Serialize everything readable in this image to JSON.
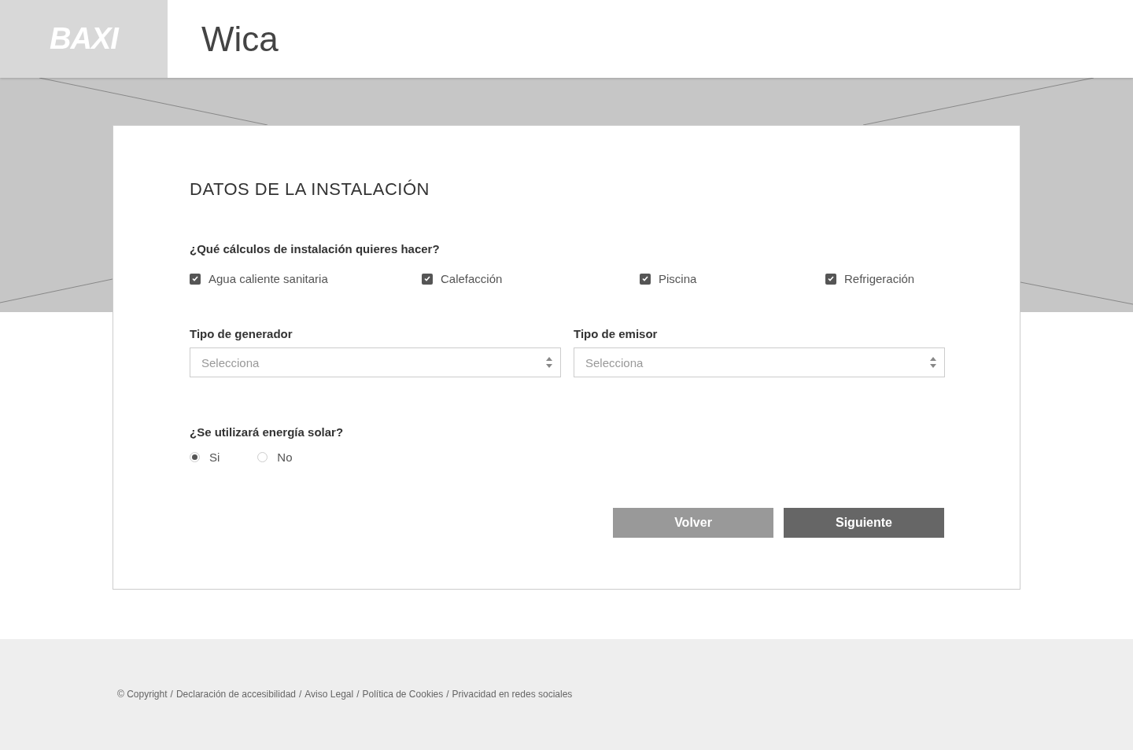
{
  "header": {
    "logo": "BAXI",
    "title": "Wica"
  },
  "form": {
    "title": "DATOS DE LA INSTALACIÓN",
    "calc_question": "¿Qué cálculos de instalación quieres hacer?",
    "calculations": [
      {
        "label": "Agua caliente sanitaria",
        "checked": true
      },
      {
        "label": "Calefacción",
        "checked": true
      },
      {
        "label": "Piscina",
        "checked": true
      },
      {
        "label": "Refrigeración",
        "checked": true
      }
    ],
    "selects": [
      {
        "label": "Tipo de generador",
        "placeholder": "Selecciona"
      },
      {
        "label": "Tipo de emisor",
        "placeholder": "Selecciona"
      }
    ],
    "solar_question": "¿Se utilizará energía solar?",
    "solar_options": [
      {
        "label": "Si",
        "selected": true
      },
      {
        "label": "No",
        "selected": false
      }
    ],
    "buttons": [
      {
        "label": "Volver",
        "kind": "secondary"
      },
      {
        "label": "Siguiente",
        "kind": "primary"
      }
    ]
  },
  "footer": {
    "separator": "/",
    "links": [
      "© Copyright",
      "Declaración de accesibilidad",
      "Aviso Legal",
      "Política de Cookies",
      "Privacidad en redes sociales"
    ]
  }
}
